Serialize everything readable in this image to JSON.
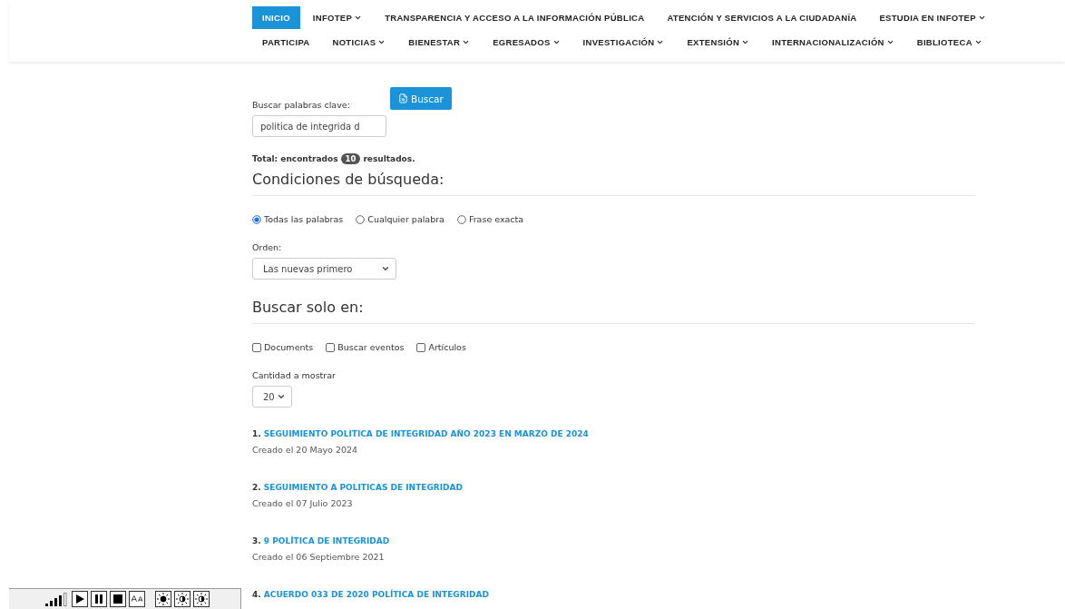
{
  "nav_rows": [
    [
      {
        "label": "INICIO",
        "selected": true,
        "dropdown": false
      },
      {
        "label": "INFOTEP",
        "selected": false,
        "dropdown": true
      },
      {
        "label": "TRANSPARENCIA Y ACCESO A LA INFORMACIÓN PÚBLICA",
        "selected": false,
        "dropdown": false
      },
      {
        "label": "ATENCIÓN Y SERVICIOS A LA CIUDADANÍA",
        "selected": false,
        "dropdown": false
      },
      {
        "label": "ESTUDIA EN INFOTEP",
        "selected": false,
        "dropdown": true
      }
    ],
    [
      {
        "label": "PARTICIPA",
        "selected": false,
        "dropdown": false
      },
      {
        "label": "NOTICIAS",
        "selected": false,
        "dropdown": true
      },
      {
        "label": "BIENESTAR",
        "selected": false,
        "dropdown": true
      },
      {
        "label": "EGRESADOS",
        "selected": false,
        "dropdown": true
      },
      {
        "label": "INVESTIGACIÓN",
        "selected": false,
        "dropdown": true
      },
      {
        "label": "EXTENSIÓN",
        "selected": false,
        "dropdown": true
      },
      {
        "label": "INTERNACIONALIZACIÓN",
        "selected": false,
        "dropdown": true
      },
      {
        "label": "BIBLIOTECA",
        "selected": false,
        "dropdown": true
      }
    ]
  ],
  "search": {
    "label": "Buscar palabras clave:",
    "value": "politica de integrida d",
    "button": "Buscar"
  },
  "total": {
    "before": "Total: encontrados",
    "count": "10",
    "after": "resultados."
  },
  "conditions": {
    "heading": "Condiciones de búsqueda:",
    "options": [
      {
        "label": "Todas las palabras",
        "selected": true
      },
      {
        "label": "Cualquier palabra",
        "selected": false
      },
      {
        "label": "Frase exacta",
        "selected": false
      }
    ],
    "order_label": "Orden:",
    "order_value": "Las nuevas primero"
  },
  "areas": {
    "heading": "Buscar solo en:",
    "options": [
      {
        "label": "Documents",
        "checked": false
      },
      {
        "label": "Buscar eventos",
        "checked": false
      },
      {
        "label": "Artículos",
        "checked": false
      }
    ],
    "count_label": "Cantidad a mostrar",
    "count_value": "20"
  },
  "results": [
    {
      "number": "1.",
      "title": "SEGUIMIENTO POLITICA DE INTEGRIDAD AÑO 2023 EN MARZO DE 2024",
      "date": "Creado el 20 Mayo 2024"
    },
    {
      "number": "2.",
      "title": "SEGUIMIENTO A POLITICAS DE INTEGRIDAD",
      "date": "Creado el 07 Julio 2023"
    },
    {
      "number": "3.",
      "title": "9 POLÍTICA DE INTEGRIDAD",
      "date": "Creado el 06 Septiembre 2021"
    },
    {
      "number": "4.",
      "title": "ACUERDO 033 DE 2020 POLÍTICA DE INTEGRIDAD"
    }
  ]
}
